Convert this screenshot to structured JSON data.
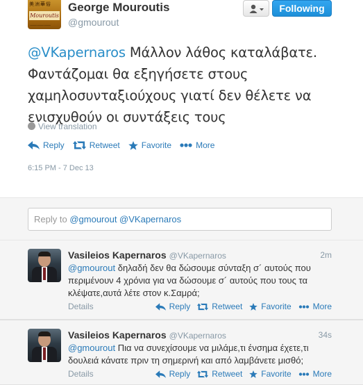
{
  "author": {
    "name": "George Mouroutis",
    "handle": "@gmourout",
    "avatar_brand": "Mouroutis",
    "avatar_cjk": "美洲華俗"
  },
  "follow_button": {
    "label": "Following"
  },
  "tweet": {
    "mention": "@VKapernaros",
    "text": " Μάλλον λάθος καταλάβατε. Φαντάζομαι θα εξηγήσετε στους χαμηλοσυνταξιούχους γιατί δεν θέλετε να ενισχυθούν οι συντάξεις τους",
    "view_translation": "View translation",
    "actions": {
      "reply": "Reply",
      "retweet": "Retweet",
      "favorite": "Favorite",
      "more": "More"
    },
    "timestamp": "6:15 PM - 7 Dec 13"
  },
  "reply_box": {
    "prefix": "Reply to",
    "mentions": "@gmourout @VKapernaros"
  },
  "replies": [
    {
      "name": "Vasileios Kapernaros",
      "handle": "@VKapernaros",
      "time": "2m",
      "mention": "@gmourout",
      "text": " δηλαδή δεν θα δώσουμε σύνταξη σ´ αυτούς που περιμένουν 4 χρόνια για να δώσουμε σ´ αυτούς που τους τα κλέψατε,αυτά λέτε στον κ.Σαμρά;",
      "details": "Details",
      "actions": {
        "reply": "Reply",
        "retweet": "Retweet",
        "favorite": "Favorite",
        "more": "More"
      }
    },
    {
      "name": "Vasileios Kapernaros",
      "handle": "@VKapernaros",
      "time": "34s",
      "mention": "@gmourout",
      "text": " Πια να συνεχίσουμε να μιλάμε,τι ένσημα έχετε,τι δουλειά κάνατε πριν τη σημερινή και από λαμβάνετε μισθό;",
      "details": "Details",
      "actions": {
        "reply": "Reply",
        "retweet": "Retweet",
        "favorite": "Favorite",
        "more": "More"
      }
    }
  ]
}
